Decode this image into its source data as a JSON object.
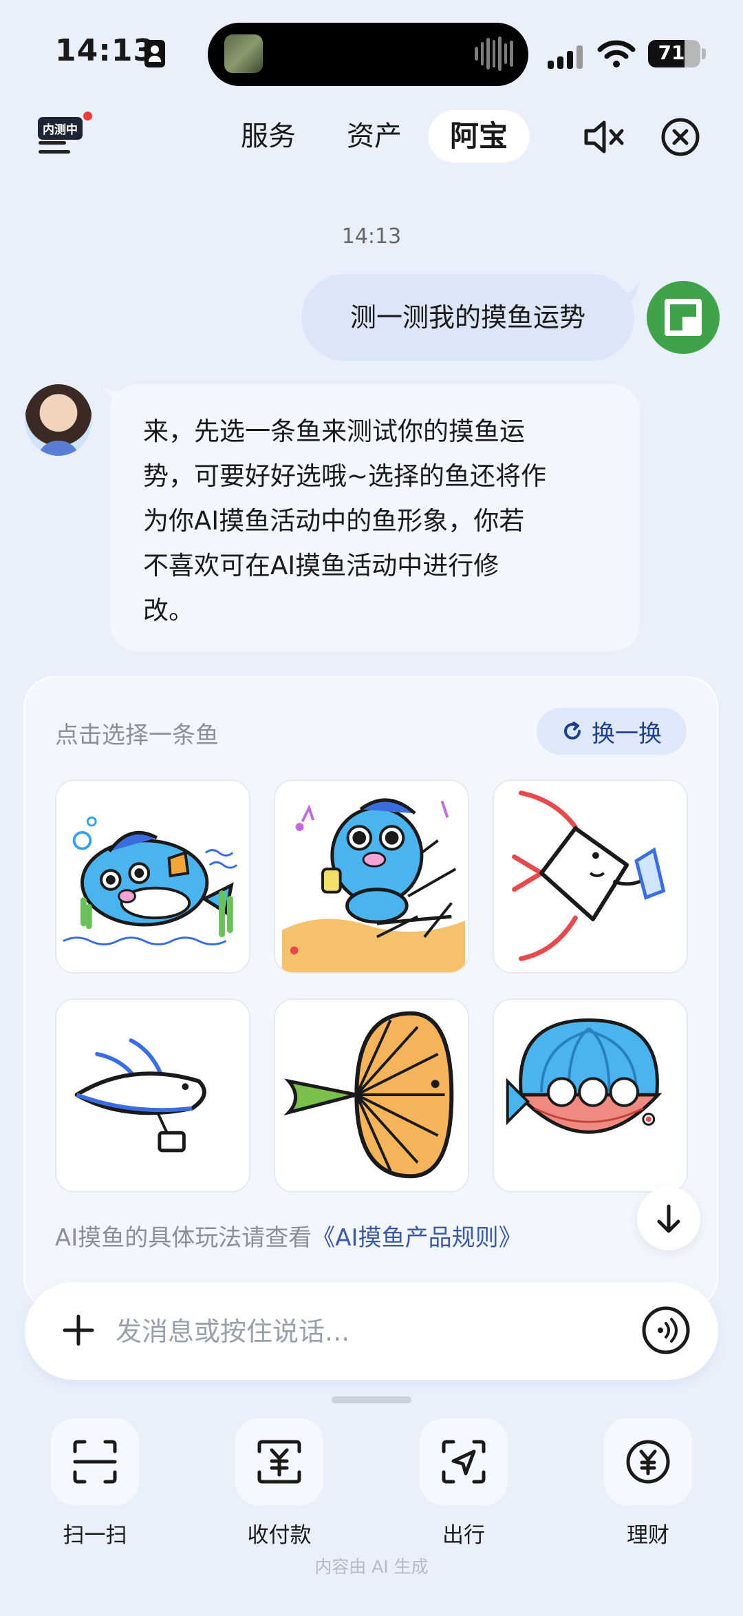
{
  "status_bar": {
    "time": "14:13",
    "battery": "71"
  },
  "header": {
    "beta_badge": "内测中",
    "tabs": [
      {
        "label": "服务"
      },
      {
        "label": "资产"
      },
      {
        "label": "阿宝",
        "active": true
      }
    ]
  },
  "chat": {
    "timestamp": "14:13",
    "user_message": "测一测我的摸鱼运势",
    "bot_message_lines": [
      "来，先选一条鱼来测试你的摸鱼运",
      "势，可要好好选哦~选择的鱼还将作",
      "为你AI摸鱼活动中的鱼形象，你若",
      "不喜欢可在AI摸鱼活动中进行修",
      "改。"
    ]
  },
  "fish_card": {
    "hint": "点击选择一条鱼",
    "swap_label": "换一换",
    "fish": [
      {
        "name": "blue-fish-swimming"
      },
      {
        "name": "blue-fish-beach-chair"
      },
      {
        "name": "diamond-fish-reading"
      },
      {
        "name": "flying-fish-bag"
      },
      {
        "name": "ginkgo-leaf-fish"
      },
      {
        "name": "clam-pearl-fish"
      }
    ],
    "rules_prefix": "AI摸鱼的具体玩法请查看",
    "rules_link": "《AI摸鱼产品规则》"
  },
  "input": {
    "placeholder": "发消息或按住说话..."
  },
  "shortcuts": [
    {
      "label": "扫一扫",
      "icon": "scan-icon"
    },
    {
      "label": "收付款",
      "icon": "payment-icon"
    },
    {
      "label": "出行",
      "icon": "travel-icon"
    },
    {
      "label": "理财",
      "icon": "wealth-icon"
    }
  ],
  "footer_note": "内容由 AI 生成",
  "colors": {
    "background": "#eaf0fb",
    "user_bubble": "#dce6f9",
    "bot_bubble": "#f2f6fd",
    "link": "#3a5aa8",
    "avatar_green": "#3ea34a"
  }
}
